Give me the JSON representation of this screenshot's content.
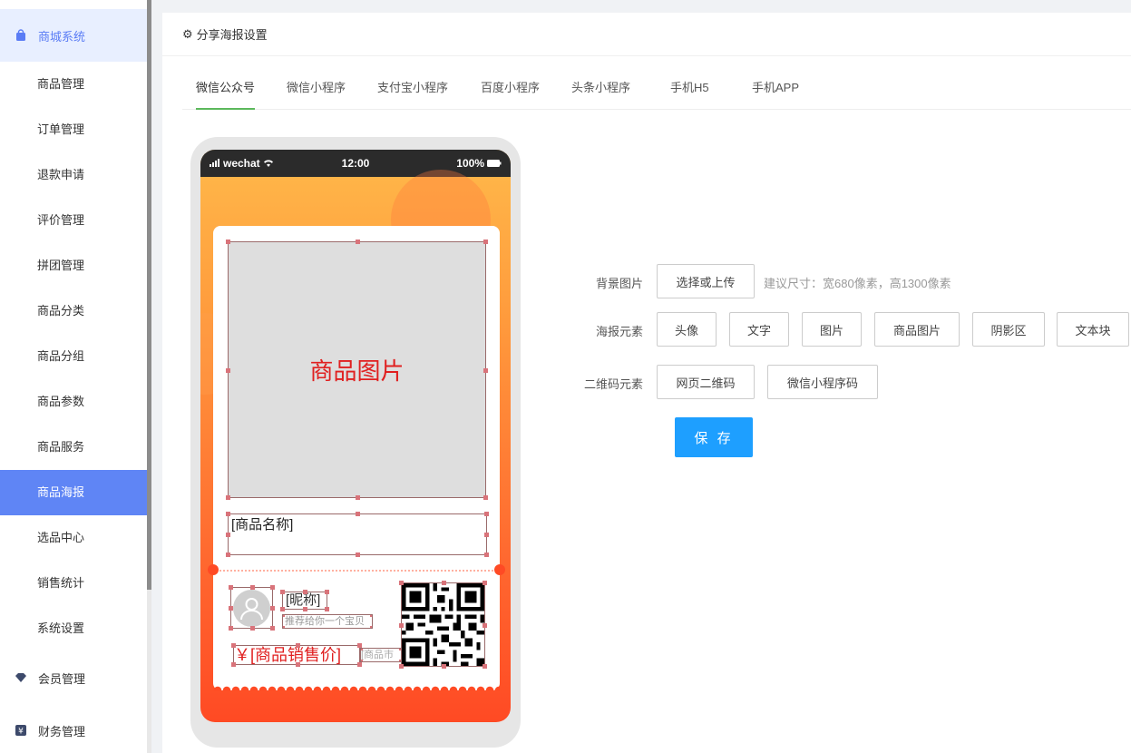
{
  "sidebar": {
    "group_mall": "商城系统",
    "items": [
      "商品管理",
      "订单管理",
      "退款申请",
      "评价管理",
      "拼团管理",
      "商品分类",
      "商品分组",
      "商品参数",
      "商品服务",
      "商品海报",
      "选品中心",
      "销售统计",
      "系统设置"
    ],
    "active_index": 9,
    "group_member": "会员管理",
    "group_finance": "财务管理"
  },
  "panel": {
    "title": "分享海报设置",
    "tabs": [
      "微信公众号",
      "微信小程序",
      "支付宝小程序",
      "百度小程序",
      "头条小程序",
      "手机H5",
      "手机APP"
    ],
    "active_tab": 0
  },
  "phone": {
    "carrier": "wechat",
    "time": "12:00",
    "battery": "100%",
    "product_image": "商品图片",
    "product_name": "[商品名称]",
    "nickname": "[昵称]",
    "recommend": "推荐给你一个宝贝",
    "price": "￥[商品销售价]",
    "market_price": "[商品市"
  },
  "form": {
    "bg_label": "背景图片",
    "bg_button": "选择或上传",
    "bg_hint": "建议尺寸：宽680像素，高1300像素",
    "elements_label": "海报元素",
    "elements": [
      "头像",
      "文字",
      "图片",
      "商品图片",
      "阴影区",
      "文本块"
    ],
    "qr_label": "二维码元素",
    "qr_elements": [
      "网页二维码",
      "微信小程序码"
    ],
    "save": "保 存"
  },
  "colors": {
    "accent": "#5f85f5",
    "save": "#1e9fff",
    "tab_active": "#5cb85c",
    "poster_red": "#e02020"
  }
}
